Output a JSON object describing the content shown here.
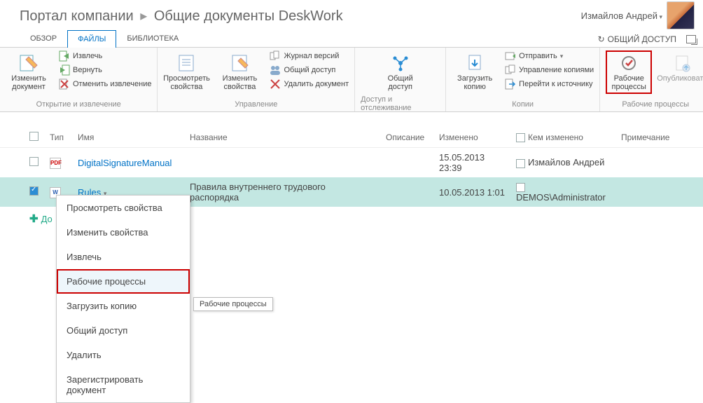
{
  "header": {
    "breadcrumb_root": "Портал компании",
    "breadcrumb_current": "Общие документы DeskWork",
    "user": "Измайлов Андрей"
  },
  "tabs": {
    "overview": "ОБЗОР",
    "files": "ФАЙЛЫ",
    "library": "БИБЛИОТЕКА",
    "share": "ОБЩИЙ ДОСТУП"
  },
  "ribbon": {
    "g1": {
      "edit_doc": "Изменить документ",
      "checkout": "Извлечь",
      "checkin": "Вернуть",
      "discard": "Отменить извлечение",
      "label": "Открытие и извлечение"
    },
    "g2": {
      "view_props": "Просмотреть свойства",
      "edit_props": "Изменить свойства",
      "versions": "Журнал версий",
      "share": "Общий доступ",
      "delete": "Удалить документ",
      "label": "Управление"
    },
    "g3": {
      "share": "Общий доступ",
      "label": "Доступ и отслеживание"
    },
    "g4": {
      "download": "Загрузить копию",
      "send": "Отправить",
      "manage_copies": "Управление копиями",
      "goto_source": "Перейти к источнику",
      "label": "Копии"
    },
    "g5": {
      "workflows": "Рабочие процессы",
      "publish": "Опубликовать",
      "label": "Рабочие процессы"
    }
  },
  "columns": {
    "type": "Тип",
    "name": "Имя",
    "title": "Название",
    "desc": "Описание",
    "modified": "Изменено",
    "modified_by": "Кем изменено",
    "note": "Примечание"
  },
  "rows": [
    {
      "icon": "pdf",
      "name": "DigitalSignatureManual",
      "title": "",
      "modified": "15.05.2013 23:39",
      "modified_by": "Измайлов Андрей",
      "selected": false
    },
    {
      "icon": "doc",
      "name": "Rules",
      "title": "Правила внутреннего трудового распорядка",
      "modified": "10.05.2013 1:01",
      "modified_by": "DEMOS\\Administrator",
      "selected": true
    }
  ],
  "add_doc": "Добавить документ",
  "context_menu": {
    "view_props": "Просмотреть свойства",
    "edit_props": "Изменить свойства",
    "checkout": "Извлечь",
    "workflows": "Рабочие процессы",
    "download": "Загрузить копию",
    "share": "Общий доступ",
    "delete": "Удалить",
    "register": "Зарегистрировать документ"
  },
  "tooltip": "Рабочие процессы"
}
